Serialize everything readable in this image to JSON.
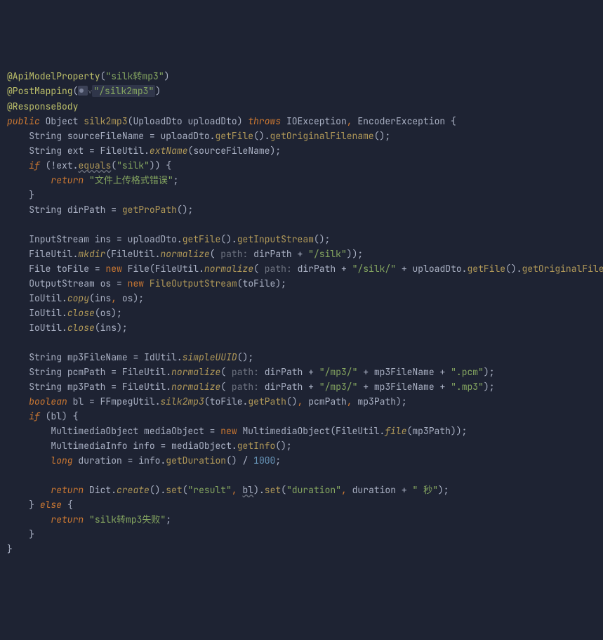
{
  "lines": {
    "l1": {
      "ann": "@ApiModelProperty",
      "s": "\"silk转mp3\""
    },
    "l2": {
      "ann": "@PostMapping",
      "s": "\"/silk2mp3\""
    },
    "l3": {
      "ann": "@ResponseBody"
    },
    "l4": {
      "kw_public": "public",
      "t_obj": "Object",
      "m": "silk2mp3",
      "p_type": "UploadDto",
      "p_name": "uploadDto",
      "kw_throws": "throws",
      "ex1": "IOException",
      "ex2": "EncoderException"
    },
    "l5": {
      "t": "String",
      "v": "sourceFileName",
      "o": "uploadDto",
      "m1": "getFile",
      "m2": "getOriginalFilename"
    },
    "l6": {
      "t": "String",
      "v": "ext",
      "c": "FileUtil",
      "m": "extName",
      "a": "sourceFileName"
    },
    "l7": {
      "kw": "if",
      "v": "ext",
      "m": "equals",
      "s": "\"silk\""
    },
    "l8": {
      "kw": "return",
      "s": "\"文件上传格式错误\""
    },
    "l10": {
      "t": "String",
      "v": "dirPath",
      "m": "getProPath"
    },
    "l12": {
      "t": "InputStream",
      "v": "ins",
      "o": "uploadDto",
      "m1": "getFile",
      "m2": "getInputStream"
    },
    "l13": {
      "c": "FileUtil",
      "m1": "mkdir",
      "m2": "normalize",
      "h": "path:",
      "v": "dirPath",
      "s": "\"/silk\""
    },
    "l14": {
      "t": "File",
      "v": "toFile",
      "kw": "new",
      "c": "File",
      "c2": "FileUtil",
      "m": "normalize",
      "h": "path:",
      "v2": "dirPath",
      "s": "\"/silk/\"",
      "o": "uploadDto",
      "m2": "getFile",
      "m3": "getOriginalFilename"
    },
    "l15": {
      "t": "OutputStream",
      "v": "os",
      "kw": "new",
      "c": "FileOutputStream",
      "a": "toFile"
    },
    "l16": {
      "c": "IoUtil",
      "m": "copy",
      "a1": "ins",
      "a2": "os"
    },
    "l17": {
      "c": "IoUtil",
      "m": "close",
      "a": "os"
    },
    "l18": {
      "c": "IoUtil",
      "m": "close",
      "a": "ins"
    },
    "l20": {
      "t": "String",
      "v": "mp3FileName",
      "c": "IdUtil",
      "m": "simpleUUID"
    },
    "l21": {
      "t": "String",
      "v": "pcmPath",
      "c": "FileUtil",
      "m": "normalize",
      "h": "path:",
      "v2": "dirPath",
      "s1": "\"/mp3/\"",
      "v3": "mp3FileName",
      "s2": "\".pcm\""
    },
    "l22": {
      "t": "String",
      "v": "mp3Path",
      "c": "FileUtil",
      "m": "normalize",
      "h": "path:",
      "v2": "dirPath",
      "s1": "\"/mp3/\"",
      "v3": "mp3FileName",
      "s2": "\".mp3\""
    },
    "l23": {
      "t": "boolean",
      "v": "bl",
      "c": "FFmpegUtil",
      "m": "silk2mp3",
      "o": "toFile",
      "m2": "getPath",
      "a2": "pcmPath",
      "a3": "mp3Path"
    },
    "l24": {
      "kw": "if",
      "v": "bl"
    },
    "l25": {
      "t": "MultimediaObject",
      "v": "mediaObject",
      "kw": "new",
      "c": "MultimediaObject",
      "c2": "FileUtil",
      "m": "file",
      "a": "mp3Path"
    },
    "l26": {
      "t": "MultimediaInfo",
      "v": "info",
      "o": "mediaObject",
      "m": "getInfo"
    },
    "l27": {
      "t": "long",
      "v": "duration",
      "o": "info",
      "m": "getDuration",
      "n": "1000"
    },
    "l29": {
      "kw": "return",
      "c": "Dict",
      "m1": "create",
      "m2": "set",
      "s1": "\"result\"",
      "v1": "bl",
      "m3": "set",
      "s2": "\"duration\"",
      "v2": "duration",
      "s3": "\" 秒\""
    },
    "l30": {
      "kw": "else"
    },
    "l31": {
      "kw": "return",
      "s": "\"silk转mp3失败\""
    }
  }
}
